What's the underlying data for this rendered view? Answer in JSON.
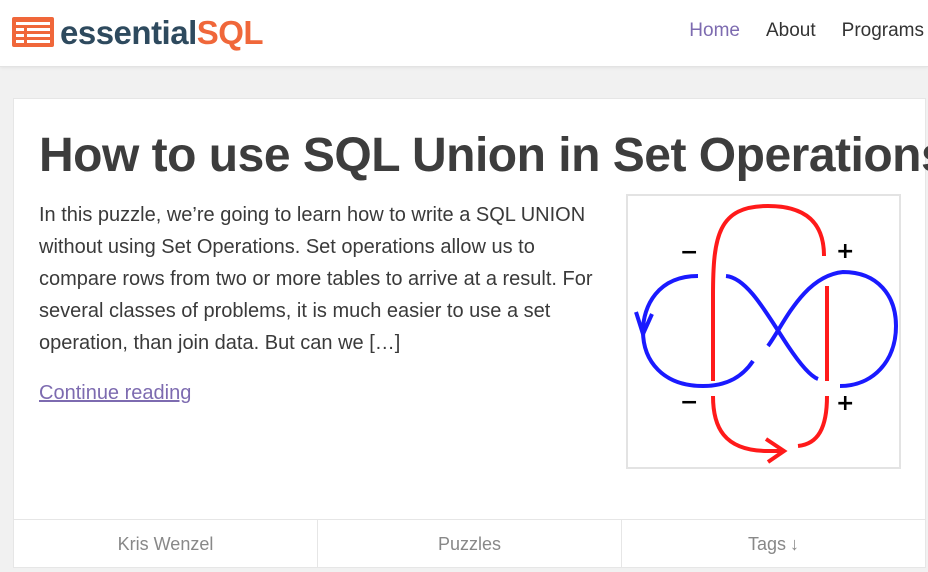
{
  "brand": {
    "part1": "essential",
    "part2": "SQL",
    "accent": "#f0673a",
    "dark": "#2e4a5e"
  },
  "nav": {
    "items": [
      {
        "label": "Home",
        "active": true
      },
      {
        "label": "About",
        "active": false
      },
      {
        "label": "Programs",
        "active": false
      }
    ]
  },
  "post": {
    "title": "How to use SQL Union in Set Operations",
    "excerpt": "  In this puzzle, we’re going to learn how to write a SQL UNION without using Set Operations.  Set operations allow us to compare rows from two or more tables to arrive at a result.   For several classes of problems, it is much easier to use a set operation, than join data.  But can we […]",
    "continue_label": "Continue reading",
    "image": {
      "icon": "knot-diagram-icon",
      "signs": [
        "−",
        "+",
        "−",
        "+"
      ],
      "colors": {
        "red": "#ff1a1a",
        "blue": "#1a1aff"
      }
    }
  },
  "meta": {
    "author": "Kris Wenzel",
    "category": "Puzzles",
    "tags_label": "Tags",
    "tags_arrow": "↓"
  },
  "colors": {
    "link": "#7d6bb0",
    "title": "#3d3d3d"
  }
}
